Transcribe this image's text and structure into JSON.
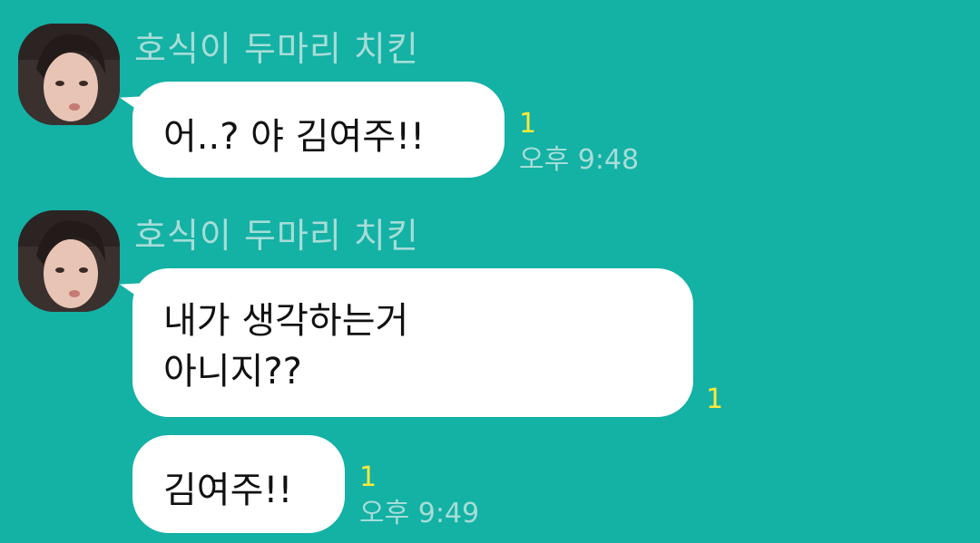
{
  "messages": [
    {
      "sender": "호식이 두마리 치킨",
      "text": "어..? 야 김여주!!",
      "unread": "1",
      "time": "오후 9:48"
    },
    {
      "sender": "호식이 두마리 치킨",
      "text_line1": "내가 생각하는거",
      "text_line2": "아니지??",
      "unread": "1"
    },
    {
      "text": "김여주!!",
      "unread": "1",
      "time": "오후 9:49"
    }
  ],
  "colors": {
    "background": "#14b1a5",
    "bubble": "#ffffff",
    "unread": "#ffe93b",
    "meta_text": "#a6ddd7"
  },
  "icons": {
    "avatar": "profile-photo"
  }
}
